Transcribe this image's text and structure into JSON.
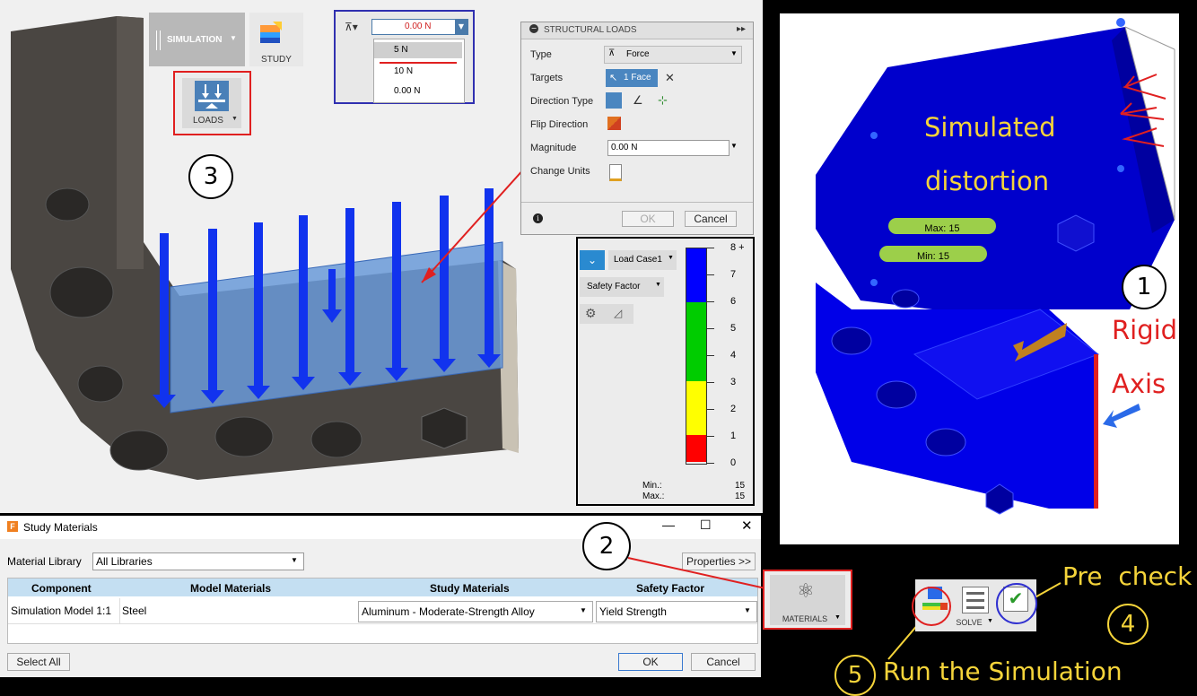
{
  "toolbar": {
    "simulation_label": "SIMULATION",
    "study_label": "STUDY",
    "loads_label": "LOADS"
  },
  "force_dropdown": {
    "value": "0.00 N",
    "options": [
      "5 N",
      "10 N",
      "0.00 N"
    ]
  },
  "structural_loads": {
    "title": "STRUCTURAL LOADS",
    "rows": {
      "type_label": "Type",
      "type_value": "Force",
      "targets_label": "Targets",
      "targets_value": "1 Face",
      "direction_type_label": "Direction Type",
      "flip_direction_label": "Flip Direction",
      "magnitude_label": "Magnitude",
      "magnitude_value": "0.00 N",
      "change_units_label": "Change Units"
    },
    "ok_label": "OK",
    "cancel_label": "Cancel"
  },
  "legend": {
    "load_case": "Load Case1",
    "result_type": "Safety Factor",
    "ticks": [
      "8 +",
      "7",
      "6",
      "5",
      "4",
      "3",
      "2",
      "1",
      "0"
    ],
    "min_label": "Min.:",
    "min_value": "15",
    "max_label": "Max.:",
    "max_value": "15",
    "colors": {
      "blue": "#0000ff",
      "green": "#00cc00",
      "yellow": "#ffff00",
      "red": "#ff0000"
    }
  },
  "study_materials": {
    "title": "Study Materials",
    "material_library_label": "Material Library",
    "material_library_value": "All Libraries",
    "properties_label": "Properties >>",
    "columns": [
      "Component",
      "Model Materials",
      "Study Materials",
      "Safety Factor"
    ],
    "rows": [
      {
        "component": "Simulation Model 1:1",
        "model_material": "Steel",
        "study_material": "Aluminum - Moderate-Strength Alloy",
        "safety_factor": "Yield Strength"
      }
    ],
    "select_all_label": "Select All",
    "ok_label": "OK",
    "cancel_label": "Cancel"
  },
  "materials_button_label": "MATERIALS",
  "solve_label": "SOLVE",
  "right_view": {
    "annotation_line1": "Simulated",
    "annotation_line2": "distortion",
    "max_tag": "Max: 15",
    "min_tag": "Min: 15",
    "rigid": "Rigid",
    "axis": "Axis"
  },
  "annotations": {
    "n1": "1",
    "n2": "2",
    "n3": "3",
    "n4": "4",
    "n5": "5",
    "pre_check": "Pre  check",
    "run_simulation": "Run the Simulation"
  }
}
